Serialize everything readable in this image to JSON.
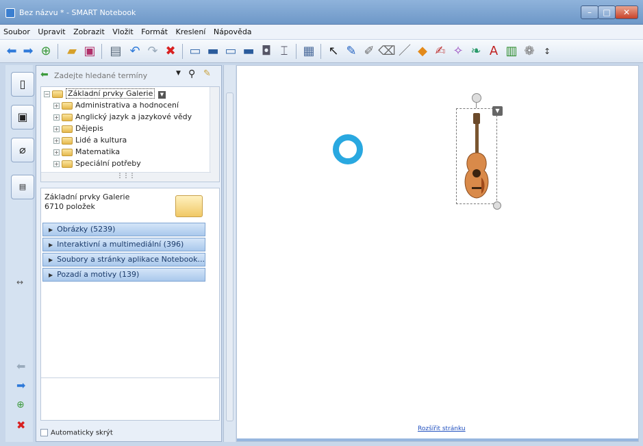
{
  "window": {
    "title": "Bez názvu * - SMART Notebook"
  },
  "menu": [
    "Soubor",
    "Upravit",
    "Zobrazit",
    "Vložit",
    "Formát",
    "Kreslení",
    "Nápověda"
  ],
  "gallery": {
    "search_placeholder": "Zadejte hledané termíny",
    "tree": {
      "root": "Základní prvky Galerie",
      "items": [
        "Administrativa a hodnocení",
        "Anglický jazyk a jazykové vědy",
        "Dějepis",
        "Lidé a kultura",
        "Matematika",
        "Speciální potřeby"
      ]
    },
    "detail": {
      "name": "Základní prvky Galerie",
      "count": "6710 položek"
    },
    "categories": [
      "Obrázky (5239)",
      "Interaktivní a multimediální (396)",
      "Soubory a stránky aplikace Notebook...",
      "Pozadí a motivy (139)"
    ],
    "autohide_label": "Automaticky skrýt"
  },
  "canvas": {
    "expand_link": "Rozšířit stránku"
  },
  "colors": {
    "ring": "#29a8e0",
    "guitar_body": "#d98a4a"
  }
}
